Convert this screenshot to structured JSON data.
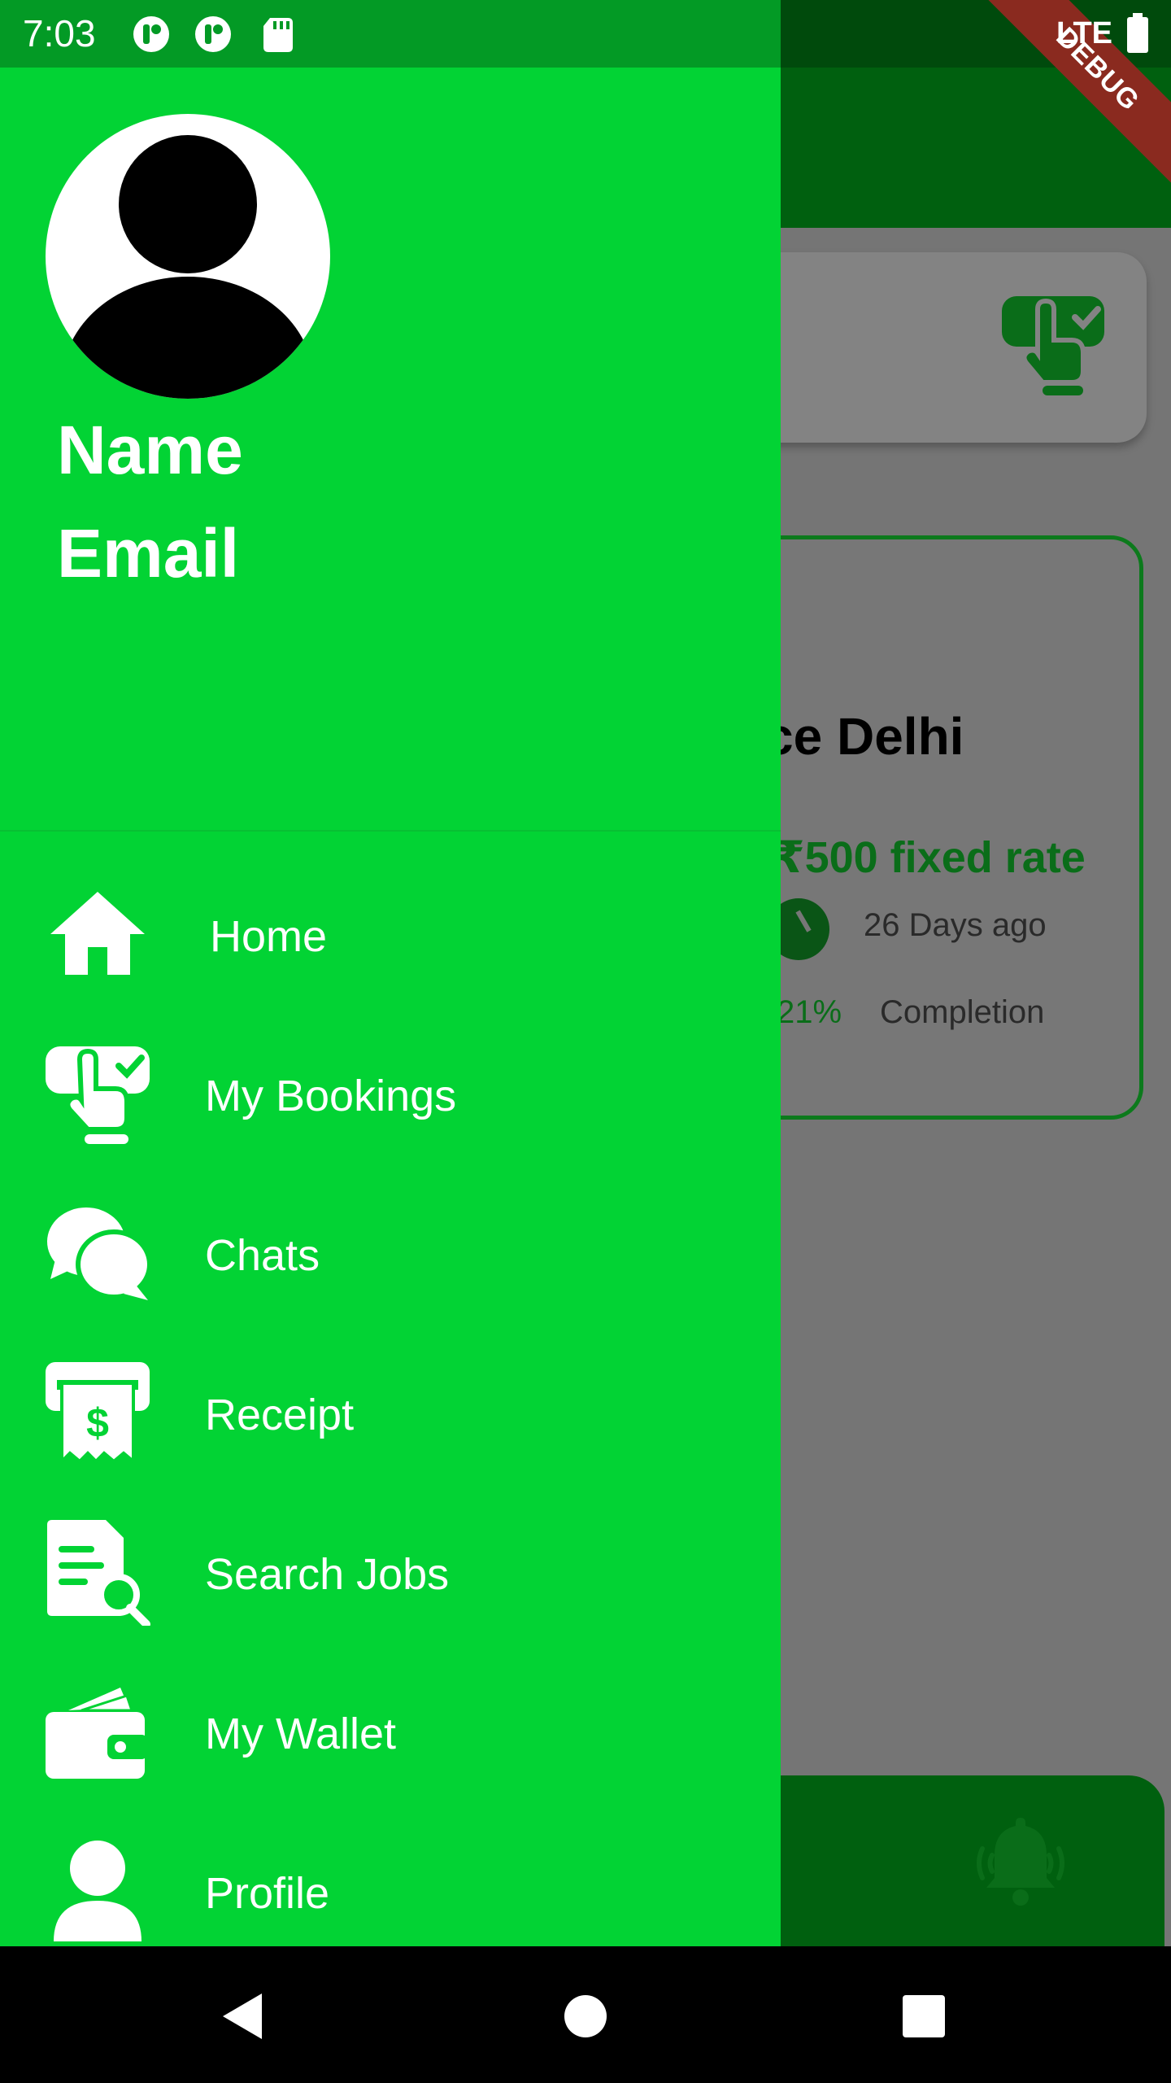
{
  "status_bar": {
    "time": "7:03",
    "network": "LTE",
    "icons": [
      "notification-app-icon",
      "notification-app-icon",
      "sd-card-icon"
    ]
  },
  "debug_banner": "DEBUG",
  "background_app": {
    "job_card": {
      "title": "ce Delhi",
      "rate": "₹500 fixed rate",
      "posted": "26 Days ago",
      "completion_percent": "21%",
      "completion_label": "Completion"
    }
  },
  "drawer": {
    "user": {
      "name": "Name",
      "email": "Email"
    },
    "menu": [
      {
        "label": "Home",
        "icon": "home-icon"
      },
      {
        "label": "My Bookings",
        "icon": "booking-icon"
      },
      {
        "label": "Chats",
        "icon": "chats-icon"
      },
      {
        "label": "Receipt",
        "icon": "receipt-icon"
      },
      {
        "label": "Search Jobs",
        "icon": "search-jobs-icon"
      },
      {
        "label": "My Wallet",
        "icon": "wallet-icon"
      },
      {
        "label": "Profile",
        "icon": "profile-icon"
      }
    ]
  },
  "colors": {
    "drawer_bg": "#02d334",
    "app_bar": "#00600f",
    "accent_green": "#0a6d19"
  }
}
